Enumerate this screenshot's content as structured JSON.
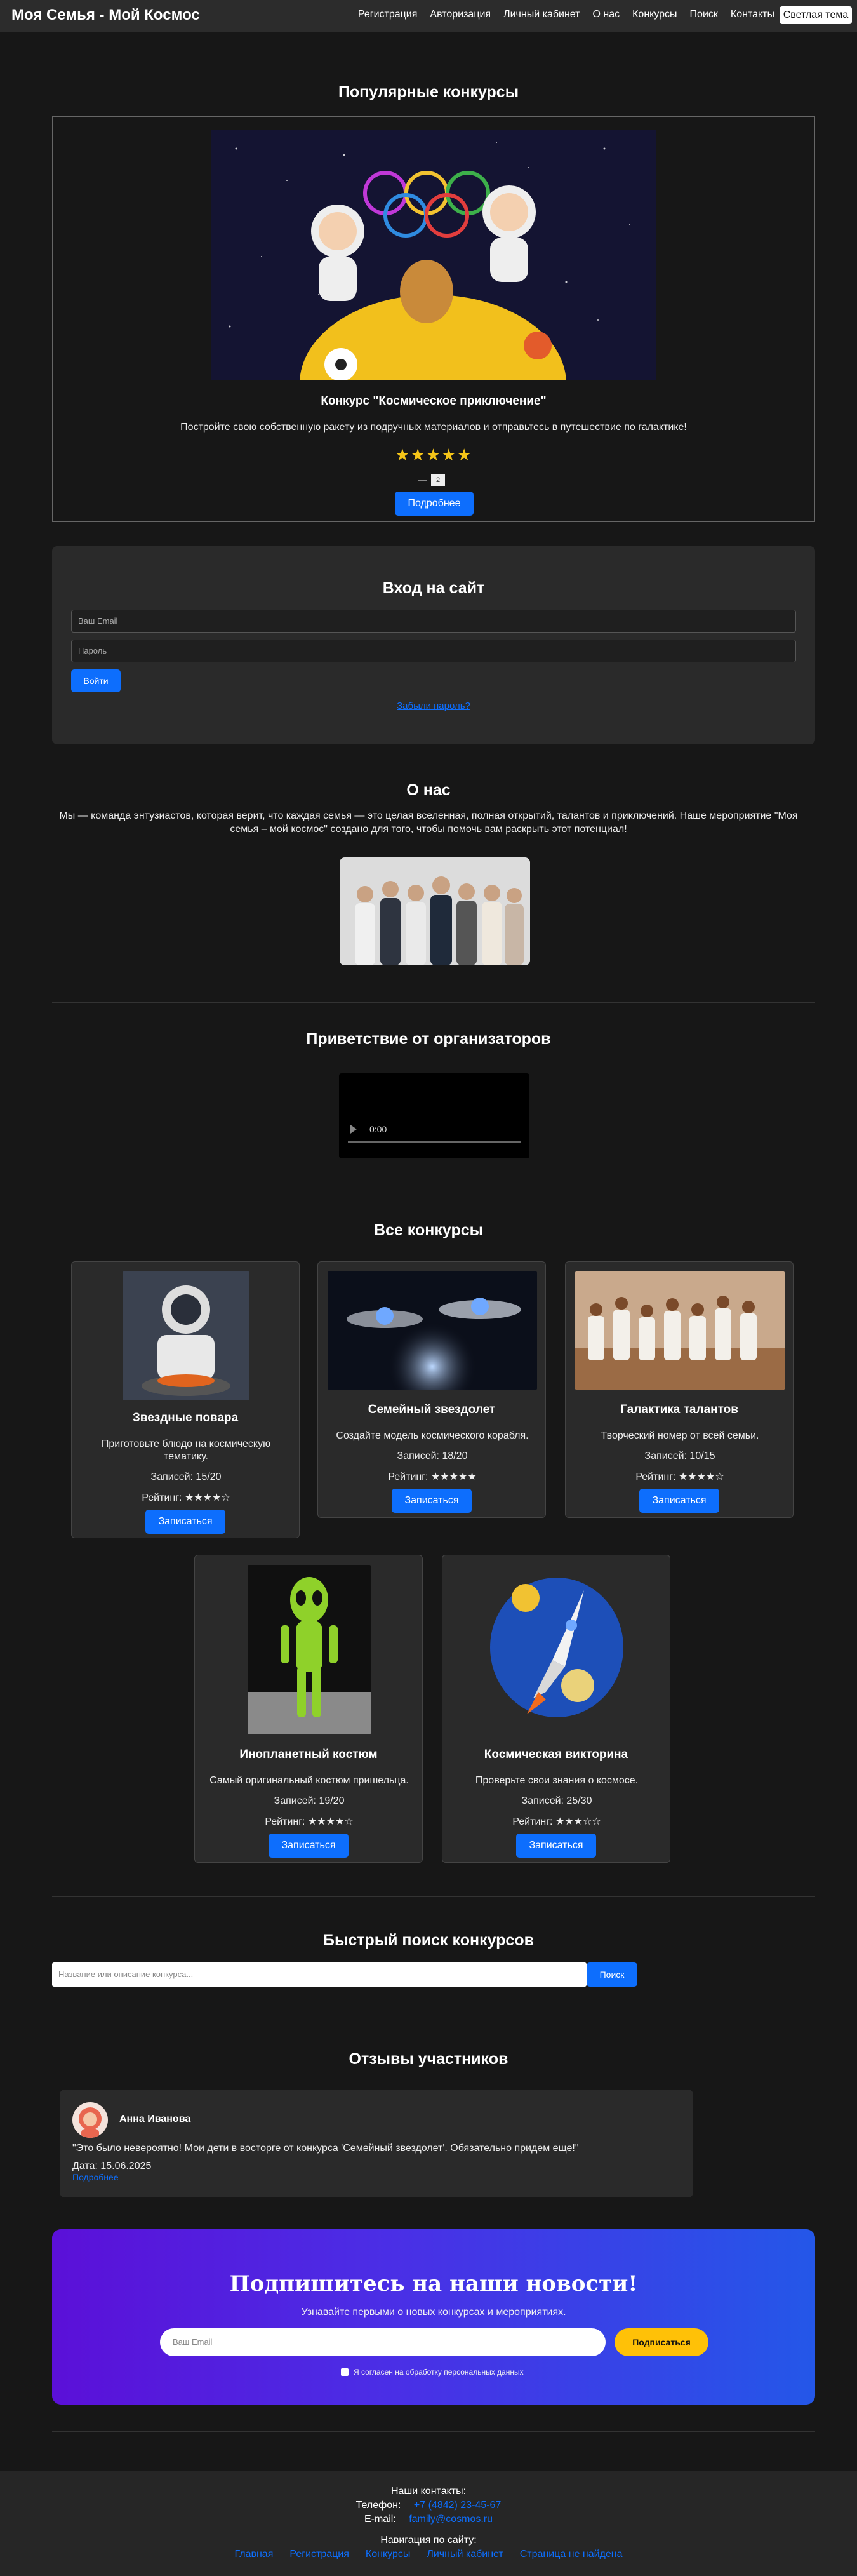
{
  "header": {
    "logo": "Моя Семья - Мой Космос",
    "nav": [
      "Регистрация",
      "Авторизация",
      "Личный кабинет",
      "О нас",
      "Конкурсы",
      "Поиск",
      "Контакты"
    ],
    "theme_button": "Светлая тема"
  },
  "popular": {
    "title": "Популярные конкурсы",
    "name": "Конкурс \"Космическое приключение\"",
    "description": "Постройте свою собственную ракету из подручных материалов и отправьтесь в путешествие по галактике!",
    "stars": "★★★★★",
    "indicator": "2",
    "more_button": "Подробнее"
  },
  "login": {
    "title": "Вход на сайт",
    "email_placeholder": "Ваш Email",
    "password_placeholder": "Пароль",
    "submit": "Войти",
    "forgot": "Забыли пароль?"
  },
  "about": {
    "title": "О нас",
    "text": "Мы — команда энтузиастов, которая верит, что каждая семья — это целая вселенная, полная открытий, талантов и приключений. Наше мероприятие \"Моя семья – мой космос\" создано для того, чтобы помочь вам раскрыть этот потенциал!"
  },
  "greeting": {
    "title": "Приветствие от организаторов",
    "time": "0:00"
  },
  "contests": {
    "title": "Все конкурсы",
    "items": [
      {
        "name": "Звездные повара",
        "description": "Приготовьте блюдо на космическую тематику.",
        "count": "Записей: 15/20",
        "rating": "Рейтинг: ★★★★☆",
        "button": "Записаться"
      },
      {
        "name": "Семейный звездолет",
        "description": "Создайте модель космического корабля.",
        "count": "Записей: 18/20",
        "rating": "Рейтинг: ★★★★★",
        "button": "Записаться"
      },
      {
        "name": "Галактика талантов",
        "description": "Творческий номер от всей семьи.",
        "count": "Записей: 10/15",
        "rating": "Рейтинг: ★★★★☆",
        "button": "Записаться"
      },
      {
        "name": "Инопланетный костюм",
        "description": "Самый оригинальный костюм пришельца.",
        "count": "Записей: 19/20",
        "rating": "Рейтинг: ★★★★☆",
        "button": "Записаться"
      },
      {
        "name": "Космическая викторина",
        "description": "Проверьте свои знания о космосе.",
        "count": "Записей: 25/30",
        "rating": "Рейтинг: ★★★☆☆",
        "button": "Записаться"
      }
    ]
  },
  "search": {
    "title": "Быстрый поиск конкурсов",
    "placeholder": "Название или описание конкурса...",
    "button": "Поиск"
  },
  "reviews": {
    "title": "Отзывы участников",
    "name": "Анна Иванова",
    "text": "\"Это было невероятно! Мои дети в восторге от конкурса 'Семейный звездолет'. Обязательно придем еще!\"",
    "date": "Дата: 15.06.2025",
    "link": "Подробнее"
  },
  "subscribe": {
    "title": "Подпишитесь на наши новости!",
    "text": "Узнавайте первыми о новых конкурсах и мероприятиях.",
    "placeholder": "Ваш Email",
    "button": "Подписаться",
    "consent": "Я согласен на обработку персональных данных"
  },
  "footer": {
    "contacts_title": "Наши контакты:",
    "phone_label": "Телефон:",
    "phone": "+7 (4842) 23-45-67",
    "email_label": "E-mail:",
    "email": "family@cosmos.ru",
    "nav_title": "Навигация по сайту:",
    "nav": [
      "Главная",
      "Регистрация",
      "Конкурсы",
      "Личный кабинет",
      "Страница не найдена"
    ]
  },
  "colors": {
    "background": "#171717",
    "accent": "#0d6efd",
    "star": "#f5c518",
    "subscribe_button": "#ffc107"
  }
}
